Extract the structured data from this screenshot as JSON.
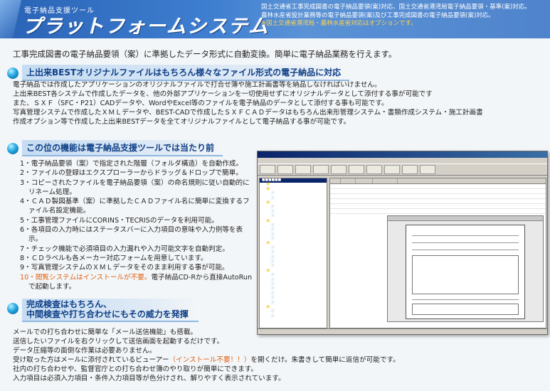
{
  "banner": {
    "subtitle": "電子納品支援ツール",
    "title": "プラットフォームシステム",
    "note1": "国土交通省工事完成図書の電子納品要領(案)対応、国土交通省港湾局電子納品要領・基準(案)対応。",
    "note2": "農林水産省設計業務等の電子納品要領(案)及び工事完成図書の電子納品要領(案)対応。",
    "note3": "※国土交通省港湾局・農林水産省対応はオプションです。"
  },
  "lead": "工事完成図書の電子納品要領（案）に準拠したデータ形式に自動変換。簡単に電子納品業務を行えます。",
  "section1": {
    "title": "上出来BESTオリジナルファイルはもちろん様々なファイル形式の電子納品に対応",
    "lines": [
      "電子納品では作成したアプリケーションのオリジナルファイルで打合せ簿や施工計画書等を納品しなければいけません。",
      "上出来BEST各システムで作成したデータを、他の外部アプリケーションを一切使用せずにオリジナルデータとして添付する事が可能です",
      "また、ＳＸＦ（SFC・P21）CADデータや、WordやExcel等のファイルを電子納品のデータとして添付する事も可能です。",
      "写真管理システムで作成したＸＭＬデータや、BEST-CADで作成したＳＸＦＣＡＤデータはもちろん出来形管理システム・書類作成システム・施工計画書",
      "作成オプション等で作成した上出来BESTデータを全てオリジナルファイルとして電子納品する事が可能です。"
    ]
  },
  "section2": {
    "title": "この位の機能は電子納品支援ツールでは当たり前",
    "items": [
      "1・電子納品要領（案）で指定された階層（フォルダ構造）を自動作成。",
      "2・ファイルの登録はエクスプローラーからドラッグ＆ドロップで簡単。",
      "3・コピーされたファイルを電子納品要領（案）の命名規則に従い自動的にリネーム処理。",
      "4・ＣＡＤ製図基準（案）に準拠したＣＡＤファイル名に簡単に変換するファイル名設定機能。",
      "5・工事管理ファイルにCORINS・TECRISのデータを利用可能。",
      "6・各項目の入力時にはステータスバーに入力項目の意味や入力例等を表示。",
      "7・チェック機能で必須項目の入力漏れや入力可能文字を自動判定。",
      "8・ＣＤラベルも各メーカー対応フォームを用意しています。",
      "9・写真管理システムのＸＭＬデータをそのまま利用する事が可能。"
    ],
    "item10_num": "10・",
    "item10_highlight": "閲覧システムはインストールが不要。",
    "item10_rest": "電子納品CD-Rから直接AutoRunで起動します。"
  },
  "section3": {
    "title_line1": "完成検査はもちろん、",
    "title_line2": "中間検査や打ち合わせにもその威力を発揮",
    "line1": "メールでの打ち合わせに簡単な「メール送信機能」も搭載。",
    "line2": "送信したいファイルを右クリックして送信画面を起動するだけです。",
    "line3": "データ圧縮等の面倒な作業は必要ありません。",
    "line4_a": "受け取った方はメールに添付されているビューアー",
    "line4_hl": "（インストール不要！！）",
    "line4_b": "を開くだけ。朱書きして簡単に返信が可能です。",
    "line5": "社内の打ち合わせや、監督官庁との打ち合わせ簿のやり取りが簡単にできます。",
    "line6": "入力項目は必須入力項目・条件入力項目等が色分けされ、解りやすく表示されています。"
  },
  "colors": {
    "accent": "#0f3f86",
    "highlight": "#e06010",
    "banner": "#2a63b6"
  }
}
